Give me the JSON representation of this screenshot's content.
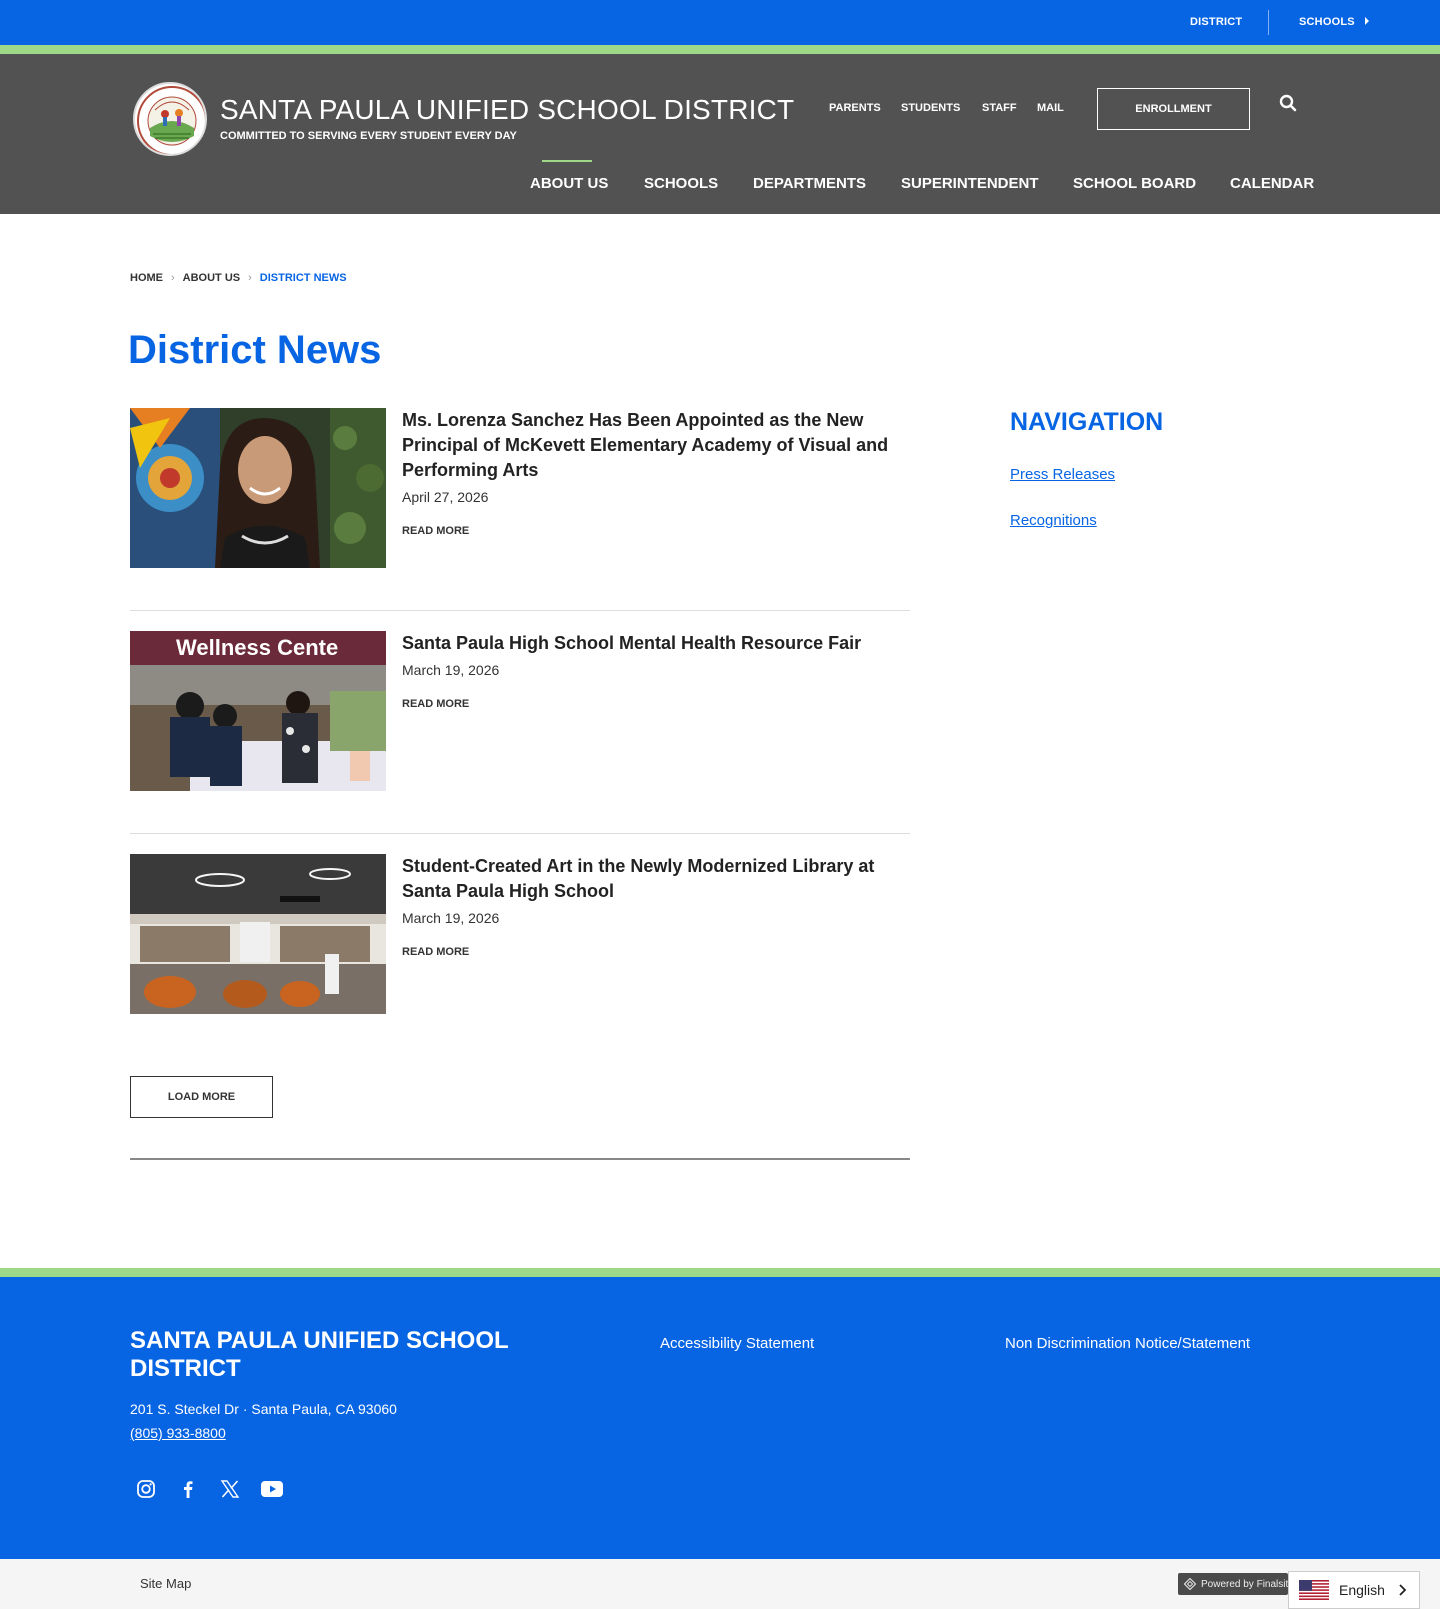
{
  "utility": {
    "district_label": "DISTRICT",
    "schools_label": "SCHOOLS"
  },
  "header": {
    "title": "SANTA PAULA UNIFIED SCHOOL DISTRICT",
    "tagline": "COMMITTED TO SERVING EVERY STUDENT EVERY DAY",
    "logo_text": "SANTA PAULA UNIFIED SCHOOL DISTRICT",
    "quick_links": [
      "PARENTS",
      "STUDENTS",
      "STAFF",
      "MAIL"
    ],
    "enroll_label": "ENROLLMENT",
    "search_icon": "search-icon",
    "main_nav": [
      "ABOUT US",
      "SCHOOLS",
      "DEPARTMENTS",
      "SUPERINTENDENT",
      "SCHOOL BOARD",
      "CALENDAR"
    ],
    "active_nav": "ABOUT US"
  },
  "breadcrumb": [
    "HOME",
    "ABOUT US",
    "DISTRICT NEWS"
  ],
  "page_title": "District News",
  "news": [
    {
      "title": "Ms. Lorenza Sanchez Has Been Appointed as the New Principal of McKevett Elementary Academy of Visual and Performing Arts",
      "date": "April 27, 2026",
      "read_more": "READ MORE"
    },
    {
      "title": "Santa Paula High School Mental Health Resource Fair",
      "date": "March 19, 2026",
      "read_more": "READ MORE",
      "image_text": "Wellness Cente"
    },
    {
      "title": "Student-Created Art in the Newly Modernized Library at Santa Paula High School",
      "date": "March 19, 2026",
      "read_more": "READ MORE"
    }
  ],
  "load_more_label": "LOAD MORE",
  "sidebar": {
    "heading": "NAVIGATION",
    "links": [
      "Press Releases",
      "Recognitions"
    ]
  },
  "footer": {
    "name": "SANTA PAULA UNIFIED SCHOOL DISTRICT",
    "address": "201 S. Steckel Dr  ·  Santa Paula, CA  93060",
    "phone": "(805) 933-8800",
    "links": [
      "Accessibility Statement",
      "Non Discrimination Notice/Statement"
    ],
    "social_icons": [
      "instagram-icon",
      "facebook-icon",
      "x-twitter-icon",
      "youtube-icon"
    ]
  },
  "bottom": {
    "site_map": "Site Map",
    "powered_by": "Powered by Finalsite",
    "language": "English"
  },
  "colors": {
    "brand_blue": "#0765e4",
    "accent_green": "#9ed98a",
    "header_gray": "#525252"
  }
}
